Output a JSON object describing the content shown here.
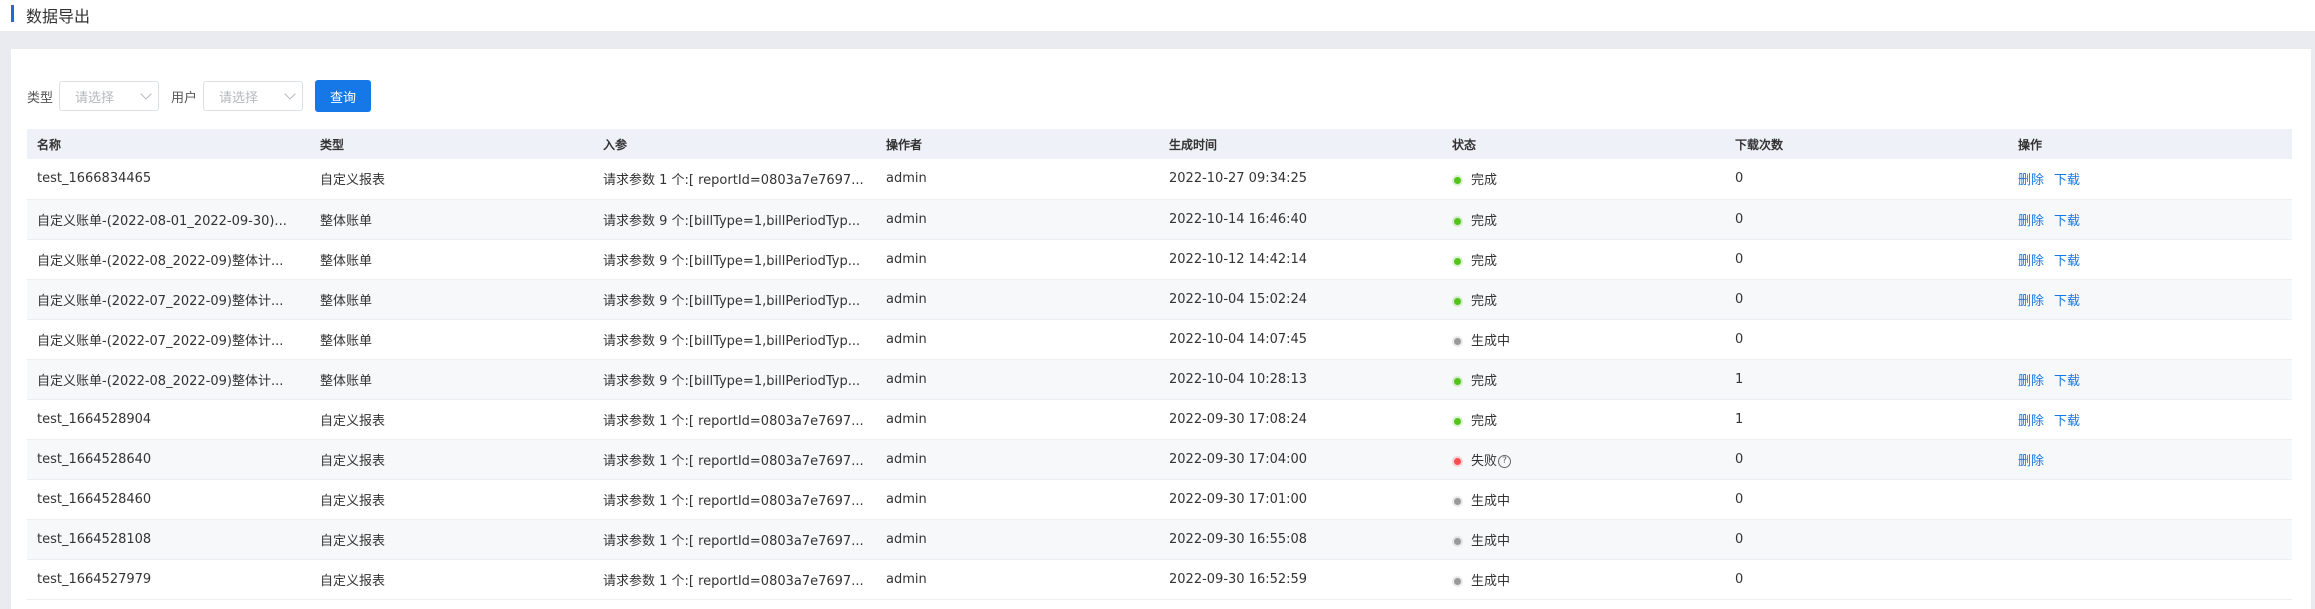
{
  "page": {
    "title": "数据导出"
  },
  "filters": {
    "type_label": "类型",
    "type_placeholder": "请选择",
    "user_label": "用户",
    "user_placeholder": "请选择",
    "search_label": "查询"
  },
  "colors": {
    "accent": "#1677e6",
    "done": "#52c41a",
    "pending": "#999999",
    "failed": "#ff4d4f"
  },
  "table": {
    "headers": [
      "名称",
      "类型",
      "入参",
      "操作者",
      "生成时间",
      "状态",
      "下载次数",
      "操作"
    ],
    "rows": [
      {
        "name": "test_1666834465",
        "type": "自定义报表",
        "params": "请求参数 1 个:[ reportId=0803a7e7697...",
        "operator": "admin",
        "time": "2022-10-27 09:34:25",
        "status": "完成",
        "status_kind": "done",
        "downloads": "0",
        "actions": [
          "删除",
          "下载"
        ]
      },
      {
        "name": "自定义账单-(2022-08-01_2022-09-30)...",
        "type": "整体账单",
        "params": "请求参数 9 个:[billType=1,billPeriodTyp...",
        "operator": "admin",
        "time": "2022-10-14 16:46:40",
        "status": "完成",
        "status_kind": "done",
        "downloads": "0",
        "actions": [
          "删除",
          "下载"
        ]
      },
      {
        "name": "自定义账单-(2022-08_2022-09)整体计...",
        "type": "整体账单",
        "params": "请求参数 9 个:[billType=1,billPeriodTyp...",
        "operator": "admin",
        "time": "2022-10-12 14:42:14",
        "status": "完成",
        "status_kind": "done",
        "downloads": "0",
        "actions": [
          "删除",
          "下载"
        ]
      },
      {
        "name": "自定义账单-(2022-07_2022-09)整体计...",
        "type": "整体账单",
        "params": "请求参数 9 个:[billType=1,billPeriodTyp...",
        "operator": "admin",
        "time": "2022-10-04 15:02:24",
        "status": "完成",
        "status_kind": "done",
        "downloads": "0",
        "actions": [
          "删除",
          "下载"
        ]
      },
      {
        "name": "自定义账单-(2022-07_2022-09)整体计...",
        "type": "整体账单",
        "params": "请求参数 9 个:[billType=1,billPeriodTyp...",
        "operator": "admin",
        "time": "2022-10-04 14:07:45",
        "status": "生成中",
        "status_kind": "pending",
        "downloads": "0",
        "actions": []
      },
      {
        "name": "自定义账单-(2022-08_2022-09)整体计...",
        "type": "整体账单",
        "params": "请求参数 9 个:[billType=1,billPeriodTyp...",
        "operator": "admin",
        "time": "2022-10-04 10:28:13",
        "status": "完成",
        "status_kind": "done",
        "downloads": "1",
        "actions": [
          "删除",
          "下载"
        ]
      },
      {
        "name": "test_1664528904",
        "type": "自定义报表",
        "params": "请求参数 1 个:[ reportId=0803a7e7697...",
        "operator": "admin",
        "time": "2022-09-30 17:08:24",
        "status": "完成",
        "status_kind": "done",
        "downloads": "1",
        "actions": [
          "删除",
          "下载"
        ]
      },
      {
        "name": "test_1664528640",
        "type": "自定义报表",
        "params": "请求参数 1 个:[ reportId=0803a7e7697...",
        "operator": "admin",
        "time": "2022-09-30 17:04:00",
        "status": "失败",
        "status_kind": "failed",
        "downloads": "0",
        "actions": [
          "删除"
        ]
      },
      {
        "name": "test_1664528460",
        "type": "自定义报表",
        "params": "请求参数 1 个:[ reportId=0803a7e7697...",
        "operator": "admin",
        "time": "2022-09-30 17:01:00",
        "status": "生成中",
        "status_kind": "pending",
        "downloads": "0",
        "actions": []
      },
      {
        "name": "test_1664528108",
        "type": "自定义报表",
        "params": "请求参数 1 个:[ reportId=0803a7e7697...",
        "operator": "admin",
        "time": "2022-09-30 16:55:08",
        "status": "生成中",
        "status_kind": "pending",
        "downloads": "0",
        "actions": []
      },
      {
        "name": "test_1664527979",
        "type": "自定义报表",
        "params": "请求参数 1 个:[ reportId=0803a7e7697...",
        "operator": "admin",
        "time": "2022-09-30 16:52:59",
        "status": "生成中",
        "status_kind": "pending",
        "downloads": "0",
        "actions": []
      }
    ]
  }
}
